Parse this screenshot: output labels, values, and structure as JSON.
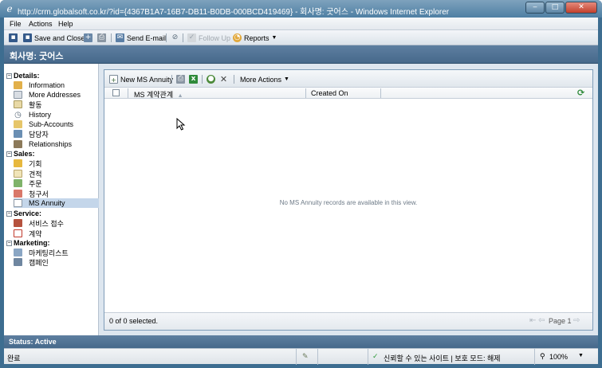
{
  "window": {
    "title": "http://crm.globalsoft.co.kr/?id={4367B1A7-16B7-DB11-B0DB-000BCD419469} - 회사명: 굿어스 - Windows Internet Explorer",
    "minimize": "‒",
    "maximize": "□",
    "close": "✕"
  },
  "menu": {
    "file": "File",
    "actions": "Actions",
    "help": "Help"
  },
  "toolbar": {
    "save_and_close": "Save and Close",
    "send_email": "Send E-mail",
    "follow_up": "Follow Up",
    "reports": "Reports"
  },
  "header": {
    "title": "회사명: 굿어스"
  },
  "nav": {
    "details": {
      "heading": "Details:",
      "items": [
        {
          "label": "Information",
          "icon": "information-icon"
        },
        {
          "label": "More Addresses",
          "icon": "addresses-icon"
        },
        {
          "label": "활동",
          "icon": "activities-icon"
        },
        {
          "label": "History",
          "icon": "history-icon"
        },
        {
          "label": "Sub-Accounts",
          "icon": "sub-accounts-icon"
        },
        {
          "label": "담당자",
          "icon": "contacts-icon"
        },
        {
          "label": "Relationships",
          "icon": "relationships-icon"
        }
      ]
    },
    "sales": {
      "heading": "Sales:",
      "items": [
        {
          "label": "기회",
          "icon": "opportunity-icon"
        },
        {
          "label": "견적",
          "icon": "quote-icon"
        },
        {
          "label": "주문",
          "icon": "order-icon"
        },
        {
          "label": "청구서",
          "icon": "invoice-icon"
        },
        {
          "label": "MS Annuity",
          "icon": "ms-annuity-icon"
        }
      ]
    },
    "service": {
      "heading": "Service:",
      "items": [
        {
          "label": "서비스 접수",
          "icon": "service-case-icon"
        },
        {
          "label": "계약",
          "icon": "contract-icon"
        }
      ]
    },
    "marketing": {
      "heading": "Marketing:",
      "items": [
        {
          "label": "마케팅리스트",
          "icon": "marketing-list-icon"
        },
        {
          "label": "캠페인",
          "icon": "campaign-icon"
        }
      ]
    }
  },
  "grid": {
    "new_button": "New MS Annuity",
    "more_actions": "More Actions",
    "columns": [
      "MS 계약관계",
      "Created On"
    ],
    "empty_message": "No MS Annuity records are available in this view.",
    "selection_count": "0 of 0 selected.",
    "page_label": "Page 1"
  },
  "record_status": "Status: Active",
  "ie_status": {
    "left": "완료",
    "zone": "신뢰할 수 있는 사이트 | 보호 모드: 해제",
    "zoom": "100%"
  }
}
